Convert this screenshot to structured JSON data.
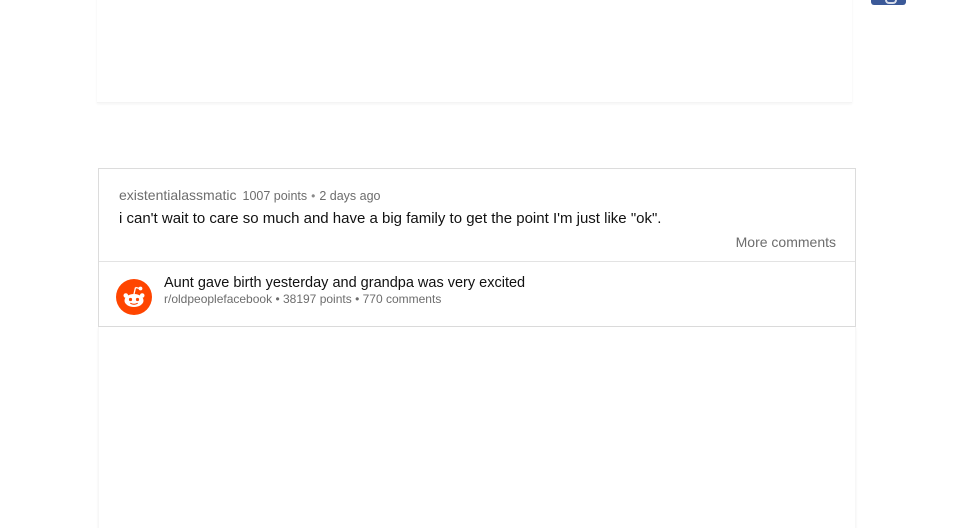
{
  "comment": {
    "username": "existentialassmatic",
    "points": "1007 points",
    "separator": "•",
    "time": "2 days ago",
    "body": "i can't wait to care so much and have a big family to get the point I'm just like \"ok\".",
    "more_comments_label": "More comments"
  },
  "post": {
    "logo_icon": "reddit-alien-icon",
    "logo_color": "#ff4500",
    "title": "Aunt gave birth yesterday and grandpa was very excited",
    "subreddit": "r/oldpeoplefacebook",
    "points": "38197 points",
    "comments": "770 comments",
    "separator": "•"
  },
  "colors": {
    "corner_tab": "#3b5998",
    "meta_text": "#6d6d6d",
    "body_text": "#111111"
  }
}
